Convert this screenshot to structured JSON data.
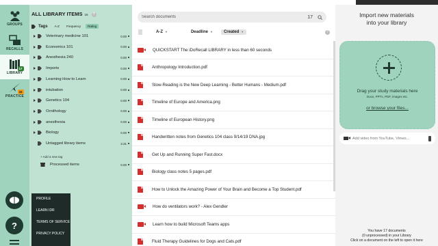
{
  "nav": {
    "items": [
      {
        "label": "GROUPS"
      },
      {
        "label": "RECALLS"
      },
      {
        "label": "LIBRARY",
        "badge": "17"
      },
      {
        "label": "PRACTICE",
        "badge": "34"
      }
    ]
  },
  "menu": {
    "items": [
      "PROFILE",
      "LEARN IDR",
      "TERMS OF SERVICE",
      "PRIVACY POLICY"
    ]
  },
  "library": {
    "title": "ALL LIBRARY ITEMS",
    "count": "16",
    "tags_label": "Tags",
    "sort_options": [
      "A-Z",
      "Frequency",
      "Rating"
    ],
    "tags": [
      {
        "name": "Veterinary medicine 101",
        "value": "0.00"
      },
      {
        "name": "Economics 101",
        "value": "0.00"
      },
      {
        "name": "Anesthesia 240",
        "value": "0.00"
      },
      {
        "name": "Imports",
        "value": "0.00"
      },
      {
        "name": "Learning How to Learn",
        "value": "0.00"
      },
      {
        "name": "intubation",
        "value": "0.00"
      },
      {
        "name": "Genetics 104",
        "value": "0.00"
      },
      {
        "name": "Ornithology",
        "value": "0.00"
      },
      {
        "name": "anesthesia",
        "value": "0.00"
      },
      {
        "name": "Biology",
        "value": "0.00"
      },
      {
        "name": "Untagged library items",
        "value": "3.31"
      }
    ],
    "add_tag": "Add a new tag",
    "processed": {
      "name": "Processed items",
      "value": "0.00"
    }
  },
  "docs": {
    "search_placeholder": "Search documents",
    "count": "17",
    "sort": [
      "A-Z",
      "Deadline",
      "Created"
    ],
    "items": [
      {
        "title": "QUICKSTART The iDoRecall LIBRARY in less than 60 seconds",
        "kind": "video"
      },
      {
        "title": "Anthropology Introduction.pdf",
        "kind": "pdf"
      },
      {
        "title": "Slow-Reading is the New Deep Learning - Better Humans - Medium.pdf",
        "kind": "pdf"
      },
      {
        "title": "Timeline of Europe and America.png",
        "kind": "pdf"
      },
      {
        "title": "Timeline of European History.png",
        "kind": "pdf"
      },
      {
        "title": "Handwritten notes from Genetics 104 class 9/14/19 DNA.jpg",
        "kind": "pdf"
      },
      {
        "title": "Get Up and Running Super Fast.docx",
        "kind": "pdf"
      },
      {
        "title": "Biology class notes 5 pages.pdf",
        "kind": "pdf"
      },
      {
        "title": "How to Unlock the Amazing Power of Your Brain and Become a Top Student.pdf",
        "kind": "pdf"
      },
      {
        "title": "How do ventilators work? - Alex Gendler",
        "kind": "video"
      },
      {
        "title": "Learn how to build Microsoft Teams apps",
        "kind": "video"
      },
      {
        "title": "Fluid Therapy Guidelines for Dogs and Cats.pdf",
        "kind": "pdf"
      }
    ]
  },
  "import": {
    "title_line1": "Import new materials",
    "title_line2": "into your library",
    "drag_text": "Drag your study materials here",
    "drag_sub": "Docs, PPTx, PDF, images etc.",
    "browse": "or browse your files...",
    "video_placeholder": "Add video from YouTube, Vimeo...",
    "summary_line1": "You have 17 documents",
    "summary_line2": "(0 unprocessed) in your Library",
    "summary_line3": "Click on a document on the left to open it here"
  },
  "colors": {
    "accent": "#9fd3bd",
    "panel": "#bfe2d3",
    "dark": "#1f3a30",
    "pdf": "#d32f2f"
  }
}
